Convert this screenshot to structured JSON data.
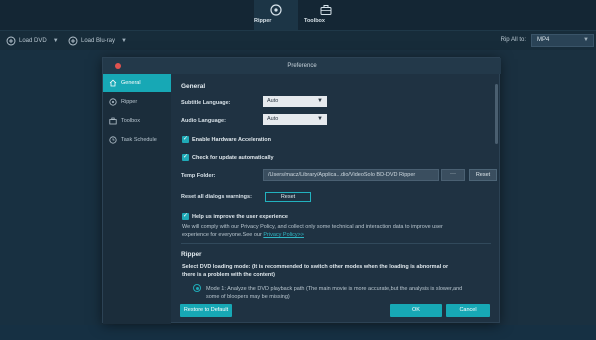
{
  "topnav": {
    "ripper_label": "Ripper",
    "toolbox_label": "Toolbox"
  },
  "toolbar": {
    "load_dvd": "Load DVD",
    "load_bluray": "Load Blu-ray",
    "rip_all_to": "Rip All to:",
    "format_value": "MP4"
  },
  "modal": {
    "title": "Preference",
    "sidebar": [
      {
        "label": "General",
        "icon": "home-icon",
        "active": true
      },
      {
        "label": "Ripper",
        "icon": "disc-icon",
        "active": false
      },
      {
        "label": "Toolbox",
        "icon": "briefcase-icon",
        "active": false
      },
      {
        "label": "Task Schedule",
        "icon": "clock-icon",
        "active": false
      }
    ],
    "general": {
      "heading": "General",
      "subtitle_language_label": "Subtitle Language:",
      "subtitle_language_value": "Auto",
      "audio_language_label": "Audio Language:",
      "audio_language_value": "Auto",
      "hw_accel_label": "Enable Hardware Acceleration",
      "check_update_label": "Check for update automatically",
      "temp_folder_label": "Temp Folder:",
      "temp_folder_value": "/Users/macz/Library/Applica...dio/VideoSolo BD-DVD Ripper",
      "dots_label": "···",
      "reset_label": "Reset",
      "reset_dialogs_label": "Reset all dialogs warnings:",
      "reset_dialogs_button": "Reset",
      "improve_label": "Help us improve the user experience",
      "improve_text_1": "We will comply with our Privacy Policy, and collect only some technical and interaction data to improve user",
      "improve_text_2": "experience for everyone.See our",
      "privacy_link": "Privacy Policy>>"
    },
    "ripper": {
      "heading": "Ripper",
      "mode_text_1": "Select DVD loading mode: (It is recommended to switch other modes when the loading is abnormal or",
      "mode_text_2": "there is a problem with the content)",
      "mode1_text_1": "Mode 1: Analyze the DVD playback path (The main movie is more accurate,but the analysis is slower,and",
      "mode1_text_2": "some of bloopers may be missing)"
    },
    "footer": {
      "restore_label": "Restore to Default",
      "ok_label": "OK",
      "cancel_label": "Cancel"
    }
  },
  "colors": {
    "accent": "#17a8b5",
    "close": "#e0524f"
  }
}
